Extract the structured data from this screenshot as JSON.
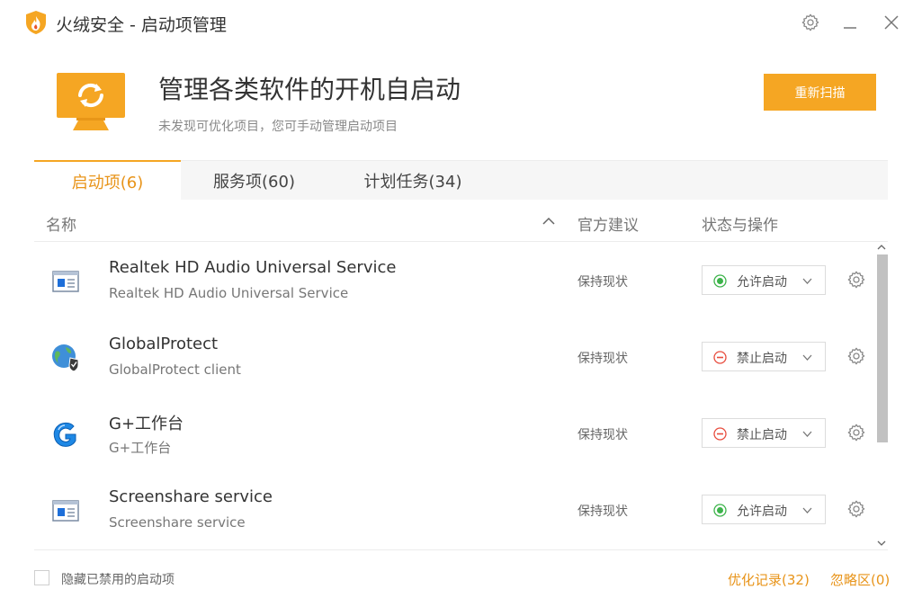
{
  "window": {
    "title": "火绒安全 - 启动项管理",
    "icons": {
      "logo": "huorong-shield-logo",
      "settings": "gear-icon",
      "minimize": "minimize-icon",
      "close": "close-icon"
    }
  },
  "header": {
    "title": "管理各类软件的开机自启动",
    "subtitle": "未发现可优化项目，您可手动管理启动项目",
    "rescan_label": "重新扫描",
    "icon": "monitor-refresh-icon"
  },
  "tabs": [
    {
      "label": "启动项(6)",
      "active": true
    },
    {
      "label": "服务项(60)",
      "active": false
    },
    {
      "label": "计划任务(34)",
      "active": false
    }
  ],
  "table": {
    "columns": {
      "name": "名称",
      "advice": "官方建议",
      "status": "状态与操作"
    },
    "rows": [
      {
        "title": "Realtek HD Audio Universal Service",
        "desc": "Realtek HD Audio Universal Service",
        "advice": "保持现状",
        "status": "允许启动",
        "status_type": "allowed",
        "icon": "service-window-icon"
      },
      {
        "title": "GlobalProtect",
        "desc": "GlobalProtect client",
        "advice": "保持现状",
        "status": "禁止启动",
        "status_type": "blocked",
        "icon": "globe-shield-icon"
      },
      {
        "title": "G+工作台",
        "desc": "G+工作台",
        "advice": "保持现状",
        "status": "禁止启动",
        "status_type": "blocked",
        "icon": "g-plus-logo-icon"
      },
      {
        "title": "Screenshare service",
        "desc": "Screenshare service",
        "advice": "保持现状",
        "status": "允许启动",
        "status_type": "allowed",
        "icon": "service-window-icon"
      }
    ]
  },
  "footer": {
    "hide_disabled_label": "隐藏已禁用的启动项",
    "hide_disabled_checked": false,
    "history_link": "优化记录(32)",
    "ignore_link": "忽略区(0)"
  },
  "colors": {
    "accent": "#f5a623",
    "accent_text": "#e8941a",
    "allowed": "#3cb34a",
    "blocked": "#e84c3d"
  }
}
